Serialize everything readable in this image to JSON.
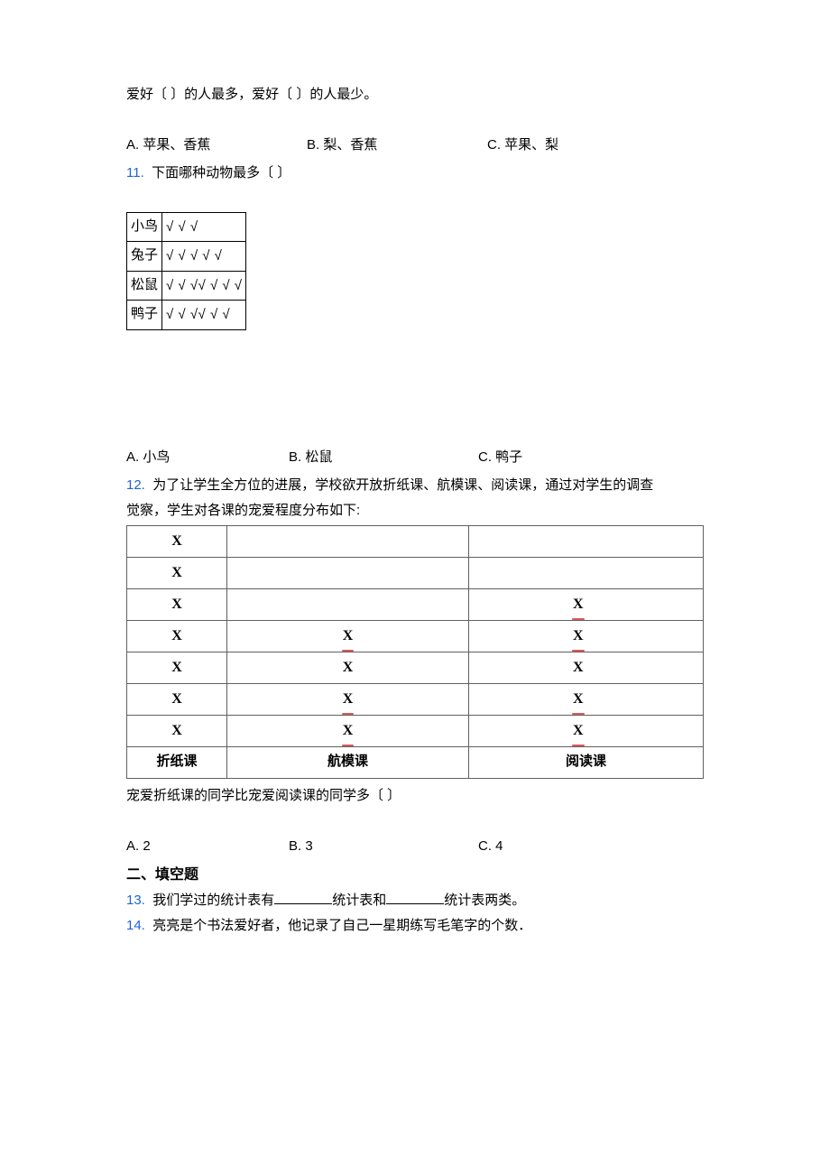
{
  "q10": {
    "line": "爱好〔  〕的人最多，爱好〔  〕的人最少。",
    "options": {
      "a": "A. 苹果、香蕉",
      "b": "B. 梨、香蕉",
      "c": "C. 苹果、梨"
    }
  },
  "q11": {
    "num": "11.",
    "prompt": "下面哪种动物最多〔  〕",
    "animals": [
      {
        "name": "小鸟",
        "ticks": "√ √ √"
      },
      {
        "name": "兔子",
        "ticks": "√ √ √ √ √"
      },
      {
        "name": "松鼠",
        "ticks": "√ √ √√ √ √ √"
      },
      {
        "name": "鸭子",
        "ticks": "√ √ √√ √ √"
      }
    ],
    "options": {
      "a": "A. 小鸟",
      "b": "B. 松鼠",
      "c": "C. 鸭子"
    }
  },
  "q12": {
    "num": "12.",
    "line1": "为了让学生全方位的进展，学校欲开放折纸课、航模课、阅读课，通过对学生的调查",
    "line2": "觉察，学生对各课的宠爱程度分布如下:",
    "headers": [
      "折纸课",
      "航模课",
      "阅读课"
    ],
    "columns": {
      "zhezhi": [
        "X",
        "X",
        "X",
        "X",
        "X",
        "X",
        "X"
      ],
      "hangmo": [
        "",
        "",
        "",
        "X",
        "X",
        "X",
        "X"
      ],
      "yuedu": [
        "",
        "",
        "X",
        "X",
        "X",
        "X",
        "X"
      ]
    },
    "tail": "宠爱折纸课的同学比宠爱阅读课的同学多〔    〕",
    "options": {
      "a": "A. 2",
      "b": "B. 3",
      "c": "C. 4"
    }
  },
  "chart_data": {
    "type": "table",
    "title": "学生对各课的宠爱程度",
    "categories": [
      "折纸课",
      "航模课",
      "阅读课"
    ],
    "values": [
      7,
      4,
      5
    ]
  },
  "section2": "二、填空题",
  "q13": {
    "num": "13.",
    "before": "我们学过的统计表有",
    "mid": "统计表和",
    "after": "统计表两类。"
  },
  "q14": {
    "num": "14.",
    "text": "亮亮是个书法爱好者，他记录了自己一星期练写毛笔字的个数．"
  }
}
